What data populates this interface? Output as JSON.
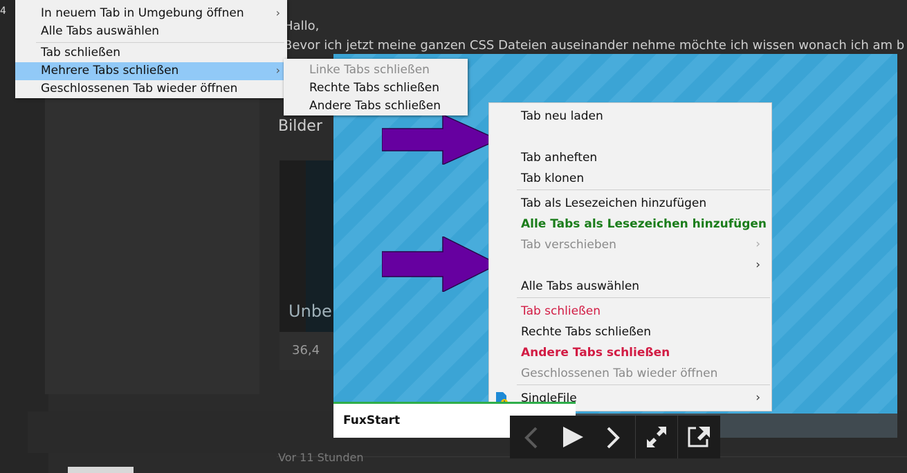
{
  "background": {
    "left_number": "4",
    "line1": "Hallo,",
    "line2": "Bevor ich jetzt meine ganzen CSS Dateien auseinander nehme möchte ich wissen wonach ich am b",
    "heading": "Bilder",
    "thumb_label": "Unbe",
    "size_text": "36,4",
    "time_text": "Vor 11 Stunden"
  },
  "context_menu": {
    "items": [
      {
        "label": "In neuem Tab in Umgebung öffnen",
        "arrow": "›"
      },
      {
        "label": "Alle Tabs auswählen"
      },
      {
        "label": "Tab schließen"
      },
      {
        "label": "Mehrere Tabs schließen",
        "arrow": "›"
      },
      {
        "label": "Geschlossenen Tab wieder öffnen"
      }
    ],
    "submenu": [
      {
        "label": "Linke Tabs schließen"
      },
      {
        "label": "Rechte Tabs schließen"
      },
      {
        "label": "Andere Tabs schließen"
      }
    ]
  },
  "lightbox": {
    "footer_label": "FuxStart",
    "menu": [
      {
        "label": "Tab neu laden"
      },
      {
        "label": "Tab anheften"
      },
      {
        "label": "Tab klonen"
      },
      {
        "label": "Tab als Lesezeichen hinzufügen"
      },
      {
        "label": "Alle Tabs als Lesezeichen hinzufügen"
      },
      {
        "label": "Tab verschieben",
        "arrow": "›"
      },
      {
        "label": "",
        "arrow": "›"
      },
      {
        "label": "Alle Tabs auswählen"
      },
      {
        "label": "Tab schließen"
      },
      {
        "label": "Rechte Tabs schließen"
      },
      {
        "label": "Andere Tabs schließen"
      },
      {
        "label": "Geschlossenen Tab wieder öffnen"
      },
      {
        "label": "SingleFile",
        "arrow": "›"
      }
    ]
  },
  "controls": [
    "prev-icon",
    "play-icon",
    "next-icon",
    "fullscreen-icon",
    "open-external-icon"
  ],
  "colors": {
    "highlight": "#91c9f7",
    "arrow": "#6600a0",
    "green_text": "#1a7d1a",
    "red_text": "#d21c44"
  }
}
